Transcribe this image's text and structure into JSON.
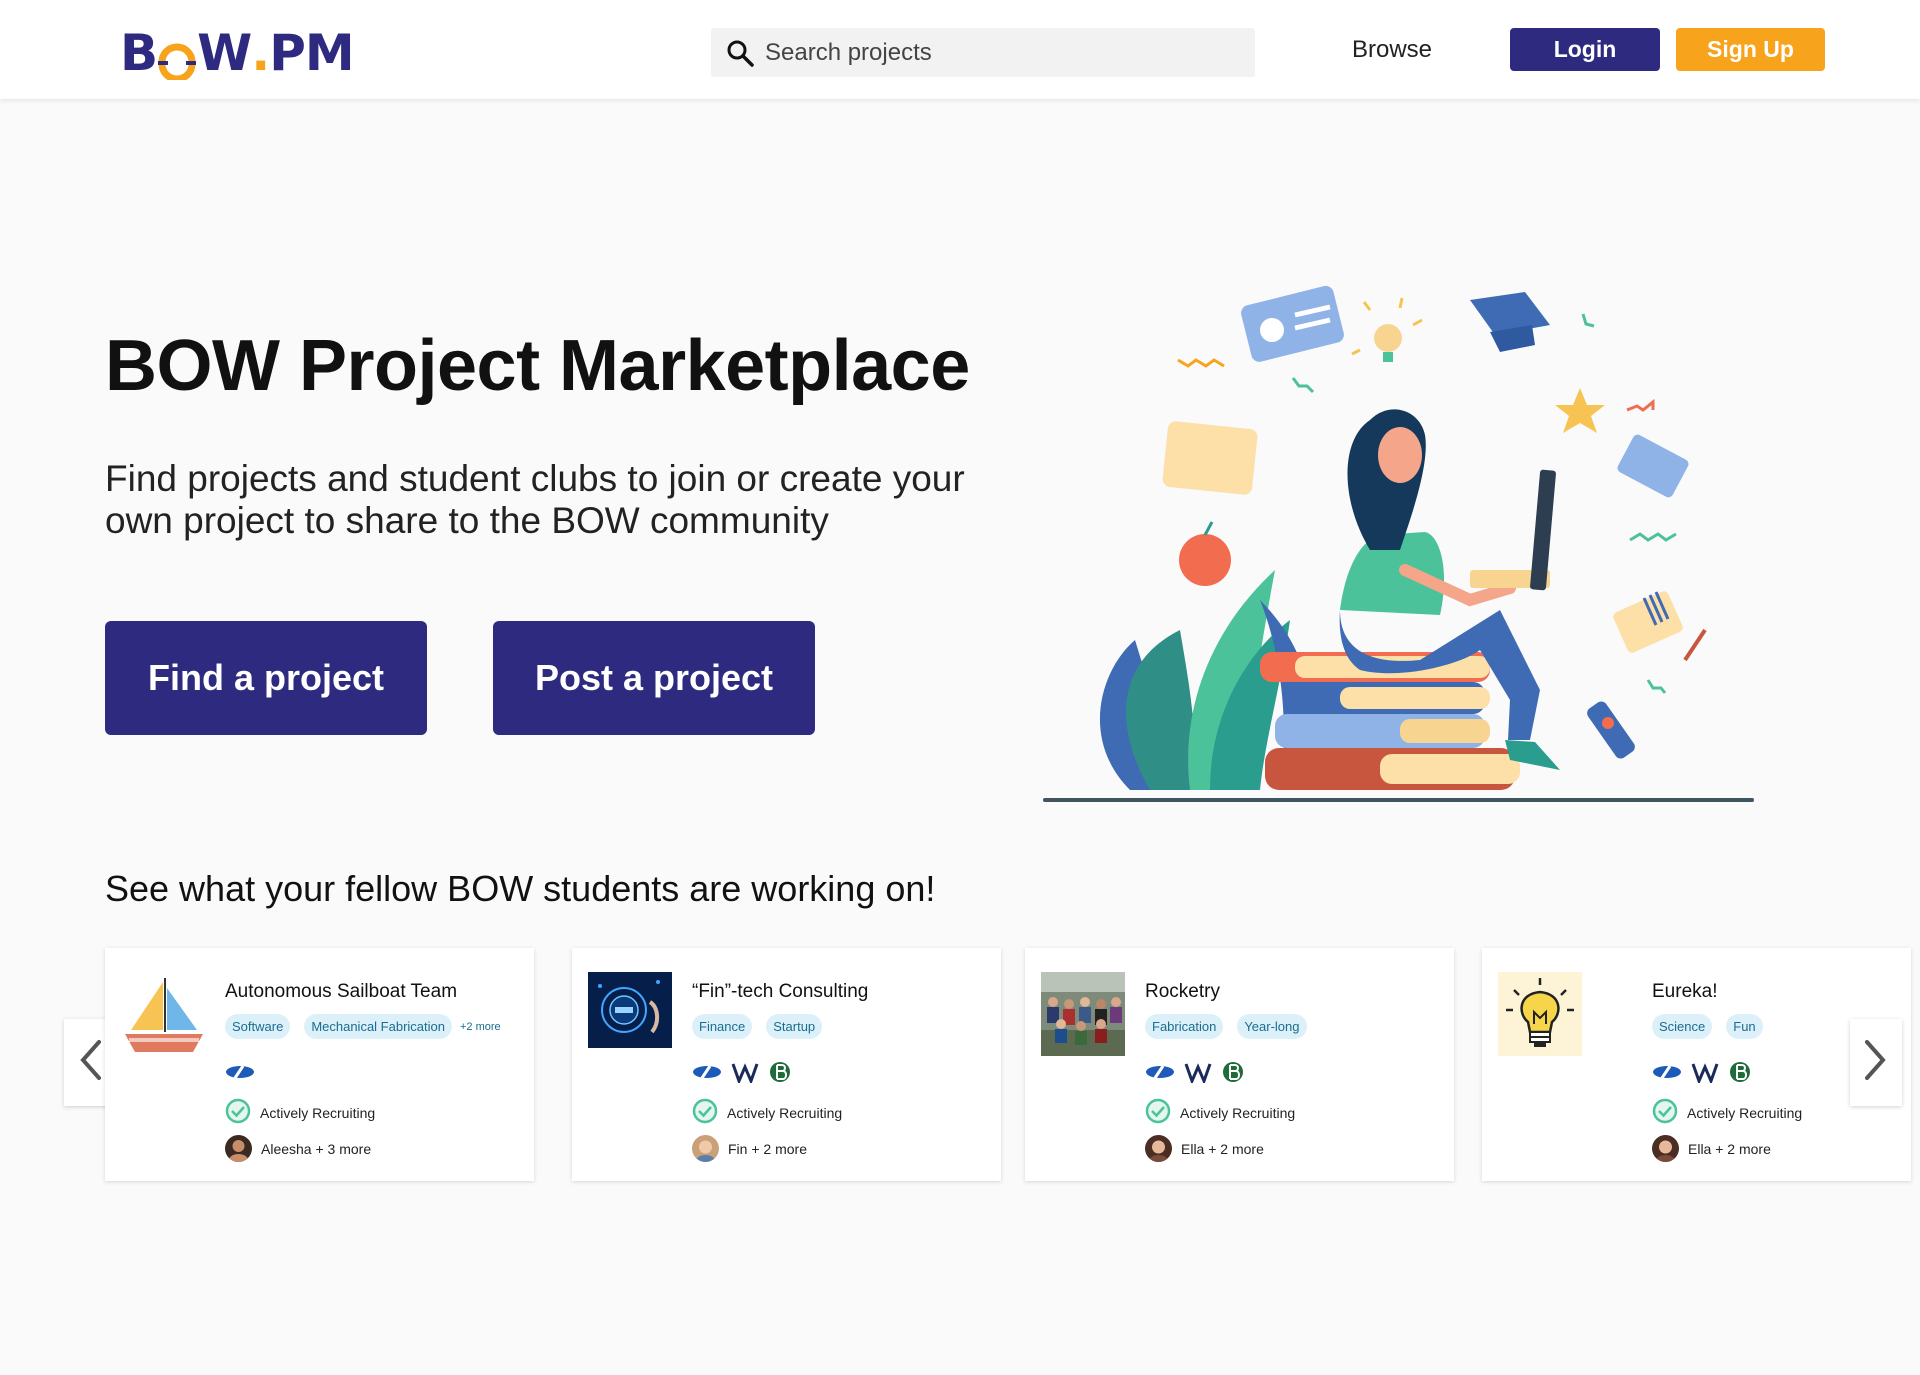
{
  "header": {
    "logo": {
      "part1": "B",
      "part2": "W",
      "dot": ".",
      "part3": "PM"
    },
    "search_placeholder": "Search projects",
    "browse_label": "Browse",
    "login_label": "Login",
    "signup_label": "Sign Up"
  },
  "hero": {
    "title": "BOW Project Marketplace",
    "subtitle": "Find projects and student clubs to join or create your own project to share to the BOW community",
    "find_label": "Find a project",
    "post_label": "Post a project"
  },
  "section_title": "See what your fellow BOW students are working on!",
  "cards": [
    {
      "title": "Autonomous Sailboat Team",
      "tags": [
        "Software",
        "Mechanical Fabrication"
      ],
      "more_tags": "+2 more",
      "status": "Actively Recruiting",
      "members": "Aleesha + 3 more"
    },
    {
      "title": "“Fin”-tech Consulting",
      "tags": [
        "Finance",
        "Startup"
      ],
      "more_tags": "",
      "status": "Actively Recruiting",
      "members": "Fin + 2 more"
    },
    {
      "title": "Rocketry",
      "tags": [
        "Fabrication",
        "Year-long"
      ],
      "more_tags": "",
      "status": "Actively Recruiting",
      "members": "Ella + 2 more"
    },
    {
      "title": "Eureka!",
      "tags": [
        "Science",
        "Fun"
      ],
      "more_tags": "",
      "status": "Actively Recruiting",
      "members": "Ella + 2 more"
    }
  ],
  "colors": {
    "primary": "#2e2a7f",
    "accent": "#f7a31c",
    "tag_bg": "#dcf0f9",
    "tag_text": "#1a6d8f",
    "check": "#4cc29a"
  },
  "icons": [
    "search-icon",
    "chevron-left-icon",
    "chevron-right-icon",
    "check-circle-icon",
    "olin-logo-icon",
    "wellesley-logo-icon",
    "babson-logo-icon"
  ]
}
